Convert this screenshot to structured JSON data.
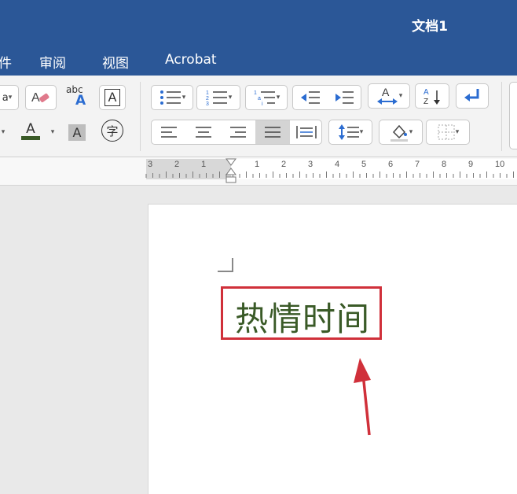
{
  "window": {
    "title": "文档1"
  },
  "menu": {
    "partial_tab": "件",
    "tabs": [
      "审阅",
      "视图",
      "Acrobat"
    ]
  },
  "ribbon": {
    "spell_label": "abc",
    "text_box_label": "A",
    "font_color_label": "A",
    "shading_label": "A",
    "enclose_char_label": "字"
  },
  "ruler": {
    "labels": [
      "3",
      "2",
      "1",
      "1",
      "2",
      "3",
      "4",
      "5",
      "6",
      "7",
      "8",
      "9",
      "10"
    ]
  },
  "document": {
    "text": "热情时间"
  },
  "colors": {
    "titlebar": "#2b5797",
    "text": "#3a5a27",
    "highlight": "#d0303a",
    "arrow": "#d0303a"
  }
}
